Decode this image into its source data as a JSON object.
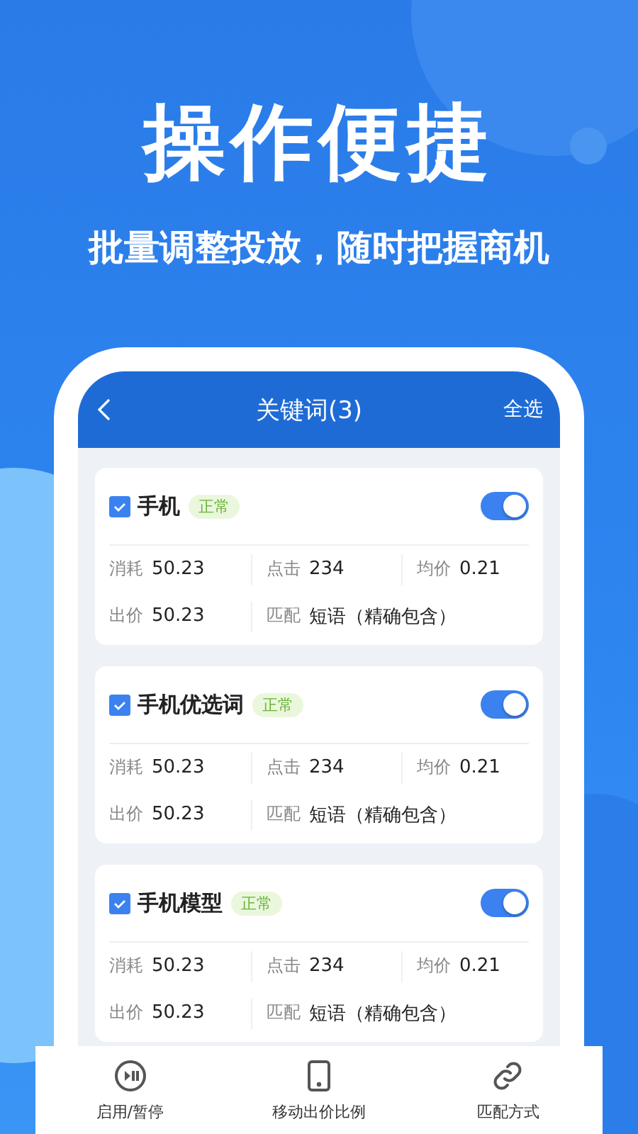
{
  "headline": "操作便捷",
  "subtitle": "批量调整投放，随时把握商机",
  "screen": {
    "title": "关键词(3)",
    "action": "全选",
    "keywords": [
      {
        "name": "手机",
        "status": "正常",
        "checked": true,
        "on": true,
        "stats": [
          [
            {
              "label": "消耗",
              "value": "50.23"
            },
            {
              "label": "点击",
              "value": "234"
            },
            {
              "label": "均价",
              "value": "0.21"
            }
          ],
          [
            {
              "label": "出价",
              "value": "50.23"
            },
            {
              "label": "匹配",
              "value": "短语（精确包含）"
            }
          ]
        ]
      },
      {
        "name": "手机优选词",
        "status": "正常",
        "checked": true,
        "on": true,
        "stats": [
          [
            {
              "label": "消耗",
              "value": "50.23"
            },
            {
              "label": "点击",
              "value": "234"
            },
            {
              "label": "均价",
              "value": "0.21"
            }
          ],
          [
            {
              "label": "出价",
              "value": "50.23"
            },
            {
              "label": "匹配",
              "value": "短语（精确包含）"
            }
          ]
        ]
      },
      {
        "name": "手机模型",
        "status": "正常",
        "checked": true,
        "on": true,
        "stats": [
          [
            {
              "label": "消耗",
              "value": "50.23"
            },
            {
              "label": "点击",
              "value": "234"
            },
            {
              "label": "均价",
              "value": "0.21"
            }
          ],
          [
            {
              "label": "出价",
              "value": "50.23"
            },
            {
              "label": "匹配",
              "value": "短语（精确包含）"
            }
          ]
        ]
      }
    ]
  },
  "toolbar": [
    {
      "kind": "play-pause",
      "label": "启用/暂停"
    },
    {
      "kind": "phone",
      "label": "移动出价比例"
    },
    {
      "kind": "link",
      "label": "匹配方式"
    }
  ]
}
